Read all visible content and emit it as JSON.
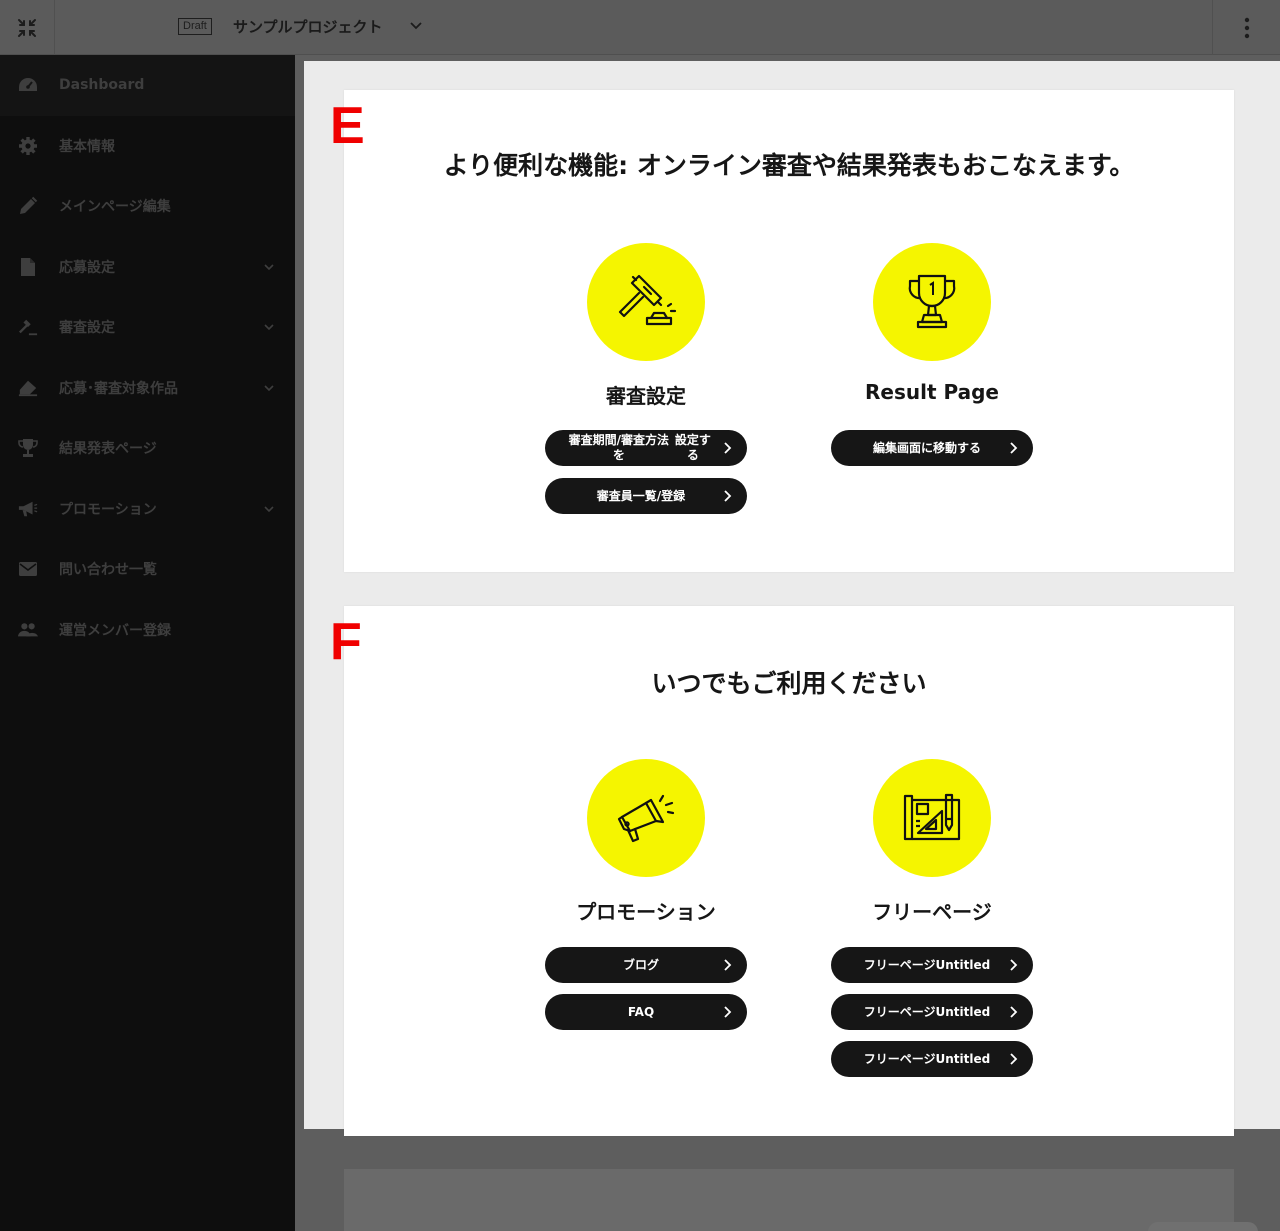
{
  "topbar": {
    "draft_label": "Draft",
    "project_name": "サンプルプロジェクト"
  },
  "sidebar": {
    "items": [
      {
        "label": "Dashboard",
        "icon": "dashboard-gauge-icon",
        "has_chevron": false
      },
      {
        "label": "基本情報",
        "icon": "gear-icon",
        "has_chevron": false
      },
      {
        "label": "メインページ編集",
        "icon": "pencil-icon",
        "has_chevron": false
      },
      {
        "label": "応募設定",
        "icon": "document-icon",
        "has_chevron": true
      },
      {
        "label": "審査設定",
        "icon": "gavel-icon",
        "has_chevron": true
      },
      {
        "label": "応募･審査対象作品",
        "icon": "eraser-icon",
        "has_chevron": true
      },
      {
        "label": "結果発表ページ",
        "icon": "trophy-icon",
        "has_chevron": false
      },
      {
        "label": "プロモーション",
        "icon": "megaphone-icon",
        "has_chevron": true
      },
      {
        "label": "問い合わせ一覧",
        "icon": "mail-icon",
        "has_chevron": false
      },
      {
        "label": "運営メンバー登録",
        "icon": "people-icon",
        "has_chevron": false
      }
    ]
  },
  "sections": {
    "e": {
      "letter": "E",
      "title": "より便利な機能: オンライン審査や結果発表もおこなえます。",
      "columns": [
        {
          "title": "審査設定",
          "icon": "gavel-icon",
          "buttons": [
            {
              "line1": "審査期間/審査方法を",
              "line2": "設定する"
            },
            {
              "line1": "審査員一覧/登録",
              "line2": ""
            }
          ]
        },
        {
          "title": "Result Page",
          "icon": "trophy-icon",
          "buttons": [
            {
              "line1": "編集画面に移動する",
              "line2": ""
            }
          ]
        }
      ]
    },
    "f": {
      "letter": "F",
      "title": "いつでもご利用ください",
      "columns": [
        {
          "title": "プロモーション",
          "icon": "megaphone-icon",
          "buttons": [
            {
              "line1": "ブログ",
              "line2": ""
            },
            {
              "line1": "FAQ",
              "line2": ""
            }
          ]
        },
        {
          "title": "フリーページ",
          "icon": "blueprint-icon",
          "buttons": [
            {
              "line1": "フリーページ",
              "line2": "Untitled"
            },
            {
              "line1": "フリーページ",
              "line2": "Untitled"
            },
            {
              "line1": "フリーページ",
              "line2": "Untitled"
            }
          ]
        }
      ]
    }
  },
  "colors": {
    "accent_yellow": "#f5f500",
    "button_dark": "#161616",
    "marker_red": "#f00000",
    "sidebar_bg": "#0e0e0e"
  }
}
